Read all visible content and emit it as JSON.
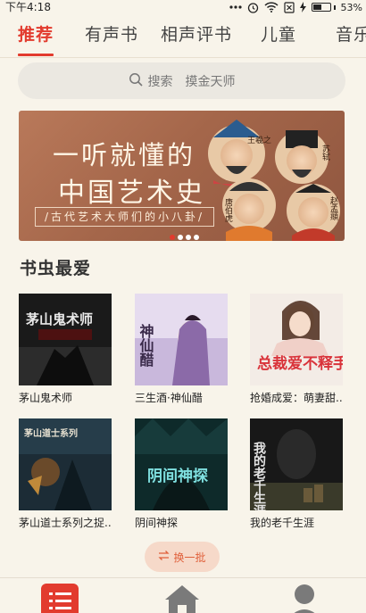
{
  "status_bar": {
    "time": "下午4:18",
    "battery_text": "53%",
    "battery_level": 0.53
  },
  "tabs": [
    {
      "label": "推荐",
      "active": true
    },
    {
      "label": "有声书",
      "active": false
    },
    {
      "label": "相声评书",
      "active": false
    },
    {
      "label": "儿童",
      "active": false
    },
    {
      "label": "音乐",
      "active": false
    }
  ],
  "search": {
    "label": "搜索",
    "hint": "摸金天师",
    "icon": "search-icon"
  },
  "banner": {
    "line1": "一听就懂的",
    "line2": "中国艺术史",
    "subtitle": "/古代艺术大师们的小八卦/",
    "portrait_labels": [
      "王羲之",
      "苏轼",
      "唐伯虎",
      "赵孟頫"
    ],
    "page_count": 4,
    "active_page": 1
  },
  "section": {
    "title": "书虫最爱"
  },
  "books": [
    {
      "title": "茅山鬼术师",
      "cover_text": "茅山鬼术师"
    },
    {
      "title": "三生酒·神仙醋",
      "cover_text": "神仙醋"
    },
    {
      "title": "抢婚成爱：萌妻甜...",
      "cover_text": "总裁爱不释手"
    },
    {
      "title": "茅山道士系列之捉...",
      "cover_text": "茅山道士系列"
    },
    {
      "title": "阴间神探",
      "cover_text": "阴间神探"
    },
    {
      "title": "我的老千生涯",
      "cover_text": "我的老千生涯"
    }
  ],
  "refresh_button": {
    "label": "换一批",
    "icon": "swap-icon"
  },
  "bottom_nav": [
    {
      "name": "list",
      "icon": "list-icon"
    },
    {
      "name": "home",
      "icon": "home-icon"
    },
    {
      "name": "profile",
      "icon": "person-icon"
    }
  ],
  "colors": {
    "accent": "#e23b2e",
    "background": "#f8f4ea",
    "search_bg": "#ebe8e1",
    "refresh_bg": "#f6d9c9",
    "refresh_text": "#e0603b"
  }
}
